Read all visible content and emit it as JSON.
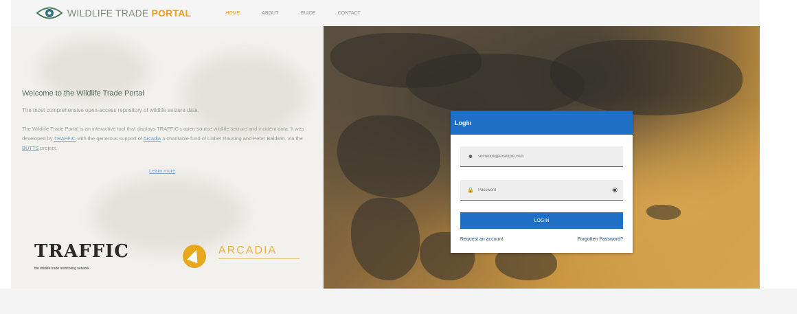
{
  "header": {
    "logo_prefix": "WILDLIFE TRADE",
    "logo_accent": "PORTAL",
    "nav": [
      {
        "label": "HOME",
        "active": true
      },
      {
        "label": "ABOUT",
        "active": false
      },
      {
        "label": "GUIDE",
        "active": false
      },
      {
        "label": "CONTACT",
        "active": false
      }
    ]
  },
  "intro": {
    "title": "Welcome to the Wildlife Trade Portal",
    "subtitle": "The most comprehensive open-access repository of wildlife seizure data.",
    "desc_1": "The Wildlife Trade Portal is an interactive tool that displays TRAFFIC's open-source wildlife seizure and incident data. It was developed by ",
    "link_traffic": "TRAFFIC",
    "desc_2": " with the generous support of ",
    "link_arcadia": "Arcadia",
    "desc_3": " a charitable fund of Lisbet Rausing and Peter Baldwin, via the ",
    "link_butts": "BUTTS",
    "desc_4": " project.",
    "learn_more": "Learn more"
  },
  "partners": {
    "traffic": "TRAFFIC",
    "traffic_tagline": "the wildlife trade monitoring network",
    "arcadia": "ARCADIA"
  },
  "login": {
    "title": "Login",
    "email_placeholder": "someone@example.com",
    "password_placeholder": "Password",
    "button": "LOGIN",
    "request": "Request an account",
    "forgot": "Forgotten Password?"
  },
  "colors": {
    "brand_blue": "#1f6fc7",
    "accent_orange": "#f39c12"
  }
}
